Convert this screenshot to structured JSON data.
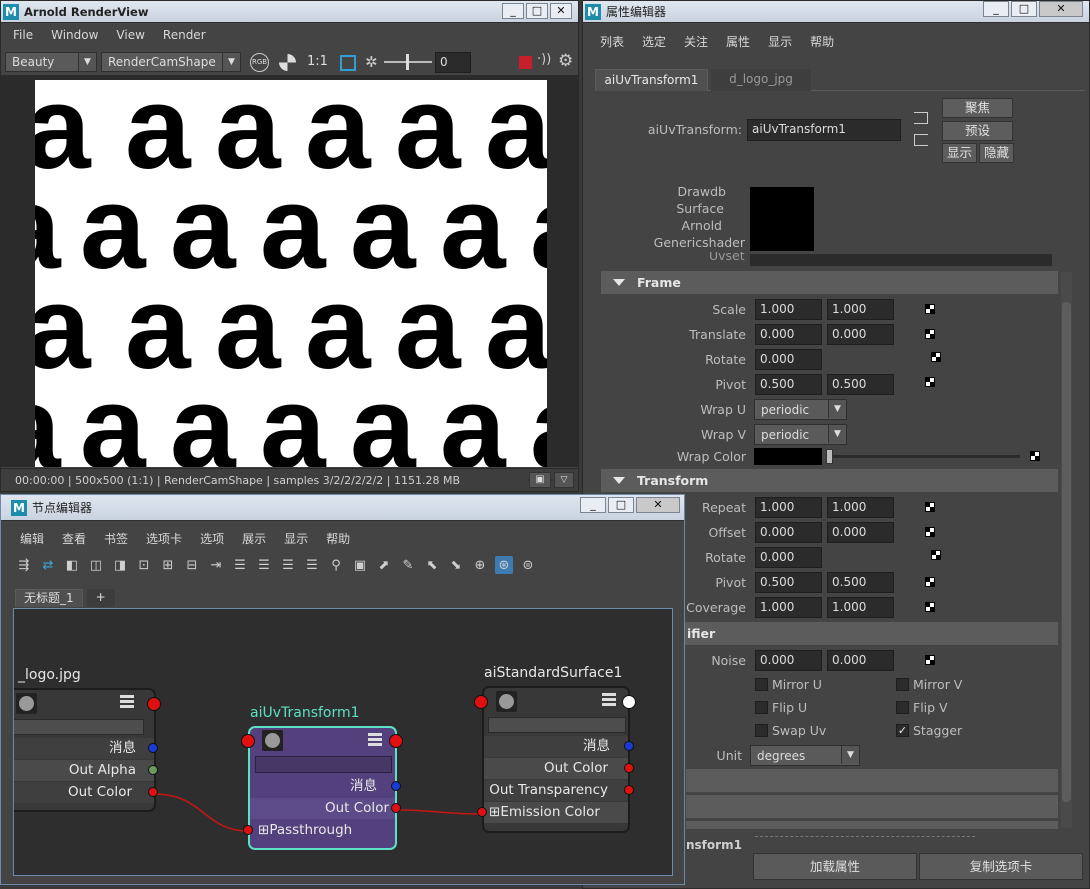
{
  "render_view": {
    "title": "Arnold RenderView",
    "menu": [
      "File",
      "Window",
      "View",
      "Render"
    ],
    "aov_select": "Beauty",
    "camera_select": "RenderCamShape",
    "zoom_label": "1:1",
    "exposure_value": "0",
    "rgb_label": "RGB",
    "status": "00:00:00 | 500x500 (1:1) | RenderCamShape  | samples 3/2/2/2/2/2 | 1151.28 MB",
    "letter": "a"
  },
  "attr_editor": {
    "title": "属性编辑器",
    "menu": [
      "列表",
      "选定",
      "关注",
      "属性",
      "显示",
      "帮助"
    ],
    "tabs": [
      "aiUvTransform1",
      "d_logo_jpg"
    ],
    "node_type_label": "aiUvTransform:",
    "node_name": "aiUvTransform1",
    "buttons": {
      "focus": "聚焦",
      "presets": "预设",
      "show": "显示",
      "hide": "隐藏"
    },
    "swatch_labels": [
      "Drawdb",
      "Surface",
      "Arnold",
      "Genericshader"
    ],
    "cut_label": "Uvset",
    "frame_section": "Frame",
    "frame": {
      "scale": {
        "label": "Scale",
        "v1": "1.000",
        "v2": "1.000"
      },
      "translate": {
        "label": "Translate",
        "v1": "0.000",
        "v2": "0.000"
      },
      "rotate": {
        "label": "Rotate",
        "v1": "0.000"
      },
      "pivot": {
        "label": "Pivot",
        "v1": "0.500",
        "v2": "0.500"
      },
      "wrap_u": {
        "label": "Wrap U",
        "value": "periodic"
      },
      "wrap_v": {
        "label": "Wrap V",
        "value": "periodic"
      },
      "wrap_color": {
        "label": "Wrap Color",
        "color": "#000000"
      }
    },
    "transform_section": "Transform",
    "transform": {
      "repeat": {
        "label": "Repeat",
        "v1": "1.000",
        "v2": "1.000"
      },
      "offset": {
        "label": "Offset",
        "v1": "0.000",
        "v2": "0.000"
      },
      "rotate": {
        "label": "Rotate",
        "v1": "0.000"
      },
      "pivot": {
        "label": "Pivot",
        "v1": "0.500",
        "v2": "0.500"
      },
      "coverage": {
        "label": "Coverage",
        "v1": "1.000",
        "v2": "1.000"
      }
    },
    "modifier_section": "ifier",
    "modifier": {
      "noise": {
        "label": "Noise",
        "v1": "0.000",
        "v2": "0.000"
      },
      "mirror_u": "Mirror U",
      "mirror_v": "Mirror V",
      "flip_u": "Flip U",
      "flip_v": "Flip V",
      "swap_uv": "Swap Uv",
      "stagger": "Stagger",
      "stagger_checked": true,
      "unit": {
        "label": "Unit",
        "value": "degrees"
      }
    },
    "bottom_cut_label": "nsform1",
    "load_button": "加载属性",
    "copy_tab_button": "复制选项卡"
  },
  "node_editor": {
    "title": "节点编辑器",
    "menu": [
      "编辑",
      "查看",
      "书签",
      "选项卡",
      "选项",
      "展示",
      "显示",
      "帮助"
    ],
    "tab": "无标题_1",
    "tab_add": "+",
    "nodes": {
      "logo": {
        "title": "_logo.jpg",
        "msg": "消息",
        "out_alpha": "Out Alpha",
        "out_color": "Out Color"
      },
      "uv": {
        "title": "aiUvTransform1",
        "msg": "消息",
        "out_color": "Out Color",
        "passthrough": "Passthrough"
      },
      "surface": {
        "title": "aiStandardSurface1",
        "msg": "消息",
        "out_color": "Out Color",
        "out_transparency": "Out Transparency",
        "emission": "Emission Color"
      }
    }
  },
  "colors": {
    "accent_teal": "#5de0c4",
    "port_red": "#e01010",
    "port_blue": "#1a3ad8",
    "port_green": "#6a9a5c",
    "uv_node": "#5a3f8a",
    "maya_blue": "#1d8dab"
  }
}
